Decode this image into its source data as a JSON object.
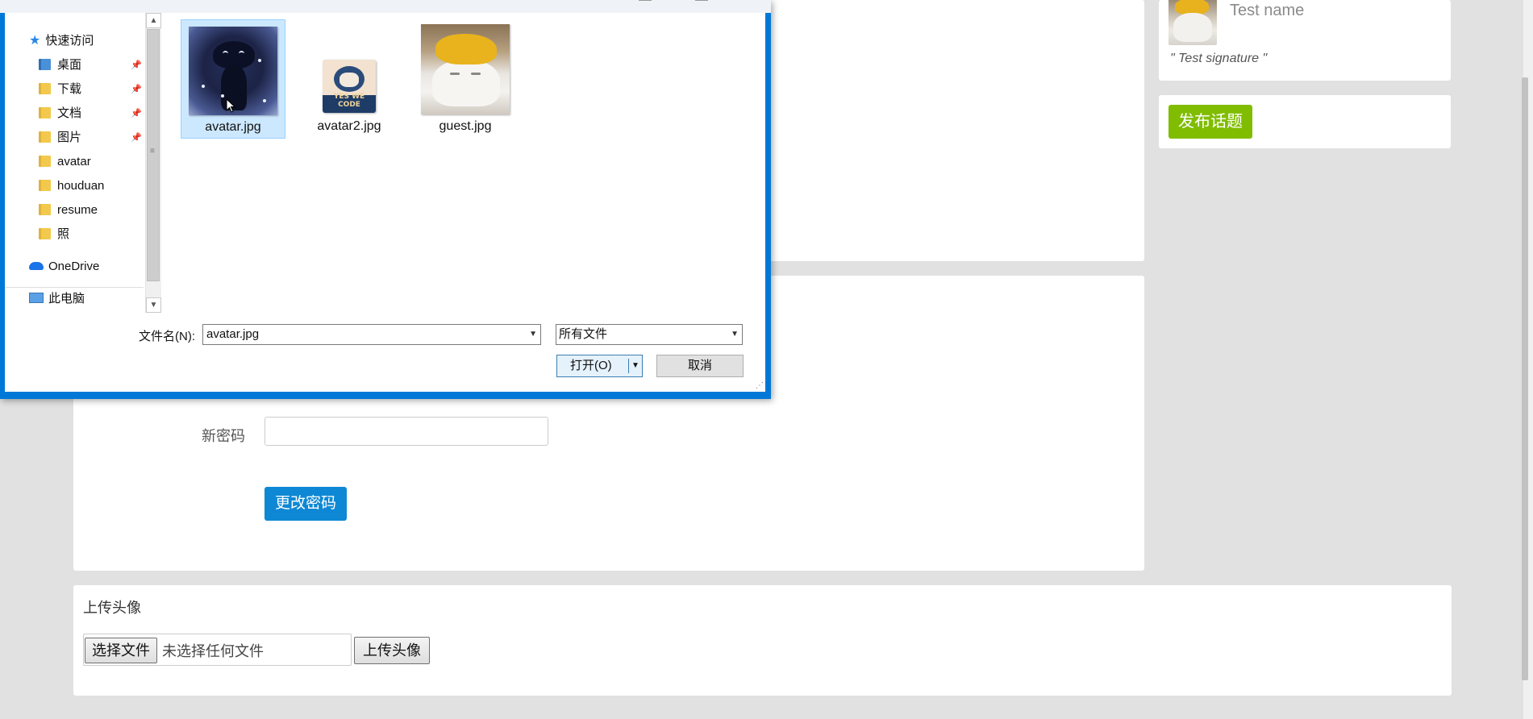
{
  "page": {
    "sidebar": {
      "user_name": "Test name",
      "signature": "\" Test signature \"",
      "publish_button": "发布话题"
    },
    "password": {
      "new_password_label": "新密码",
      "new_password_value": "",
      "change_button": "更改密码"
    },
    "avatar": {
      "title": "上传头像",
      "choose_file_button": "选择文件",
      "no_file_text": "未选择任何文件",
      "upload_button": "上传头像"
    }
  },
  "dialog": {
    "nav": {
      "items": [
        {
          "label": "快速访问",
          "icon": "star-icon"
        },
        {
          "label": "桌面",
          "icon": "folder-icon",
          "pinned": true
        },
        {
          "label": "下载",
          "icon": "download-folder-icon",
          "pinned": true
        },
        {
          "label": "文档",
          "icon": "documents-folder-icon",
          "pinned": true
        },
        {
          "label": "图片",
          "icon": "pictures-folder-icon",
          "pinned": true
        },
        {
          "label": "avatar",
          "icon": "folder-icon"
        },
        {
          "label": "houduan",
          "icon": "folder-icon"
        },
        {
          "label": "resume",
          "icon": "folder-icon"
        },
        {
          "label": "照",
          "icon": "folder-icon"
        },
        {
          "label": "OneDrive",
          "icon": "onedrive-icon"
        },
        {
          "label": "此电脑",
          "icon": "computer-icon"
        }
      ]
    },
    "files": [
      {
        "name": "avatar.jpg",
        "selected": true
      },
      {
        "name": "avatar2.jpg",
        "selected": false,
        "thumb_text": "YES WE CODE"
      },
      {
        "name": "guest.jpg",
        "selected": false
      }
    ],
    "filename_label": "文件名(N):",
    "filename_value": "avatar.jpg",
    "filetype_value": "所有文件",
    "open_button": "打开(O)",
    "cancel_button": "取消"
  },
  "colors": {
    "accent_blue": "#0e88d5",
    "accent_green": "#80bd01",
    "dialog_border": "#0078d7",
    "selection": "#cce8ff"
  }
}
